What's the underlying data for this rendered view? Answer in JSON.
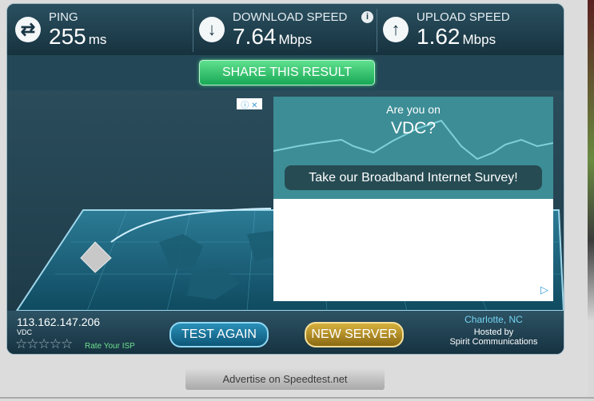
{
  "results": {
    "ping": {
      "label": "PING",
      "value": "255",
      "unit": "ms",
      "icon": "swap-arrows-icon"
    },
    "download": {
      "label": "DOWNLOAD SPEED",
      "value": "7.64",
      "unit": "Mbps",
      "icon": "download-arrow-icon",
      "info": "i"
    },
    "upload": {
      "label": "UPLOAD SPEED",
      "value": "1.62",
      "unit": "Mbps",
      "icon": "upload-arrow-icon"
    }
  },
  "share_label": "SHARE THIS RESULT",
  "ad": {
    "question": "Are you on",
    "brand": "VDC?",
    "cta": "Take our Broadband Internet Survey!",
    "choices": "ⓘ ✕",
    "arrow": "▷"
  },
  "client": {
    "ip": "113.162.147.206",
    "isp": "VDC",
    "stars": "☆☆☆☆☆",
    "rate_label": "Rate Your ISP"
  },
  "buttons": {
    "test_again": "TEST AGAIN",
    "new_server": "NEW SERVER"
  },
  "server": {
    "city": "Charlotte, NC",
    "hosted_by": "Hosted by",
    "host": "Spirit Communications"
  },
  "footer": "Advertise on Speedtest.net",
  "colors": {
    "accent_green": "#18a855",
    "panel": "#1d3e4d",
    "ad_teal": "#3d8d96",
    "gold": "#d6b13e"
  }
}
